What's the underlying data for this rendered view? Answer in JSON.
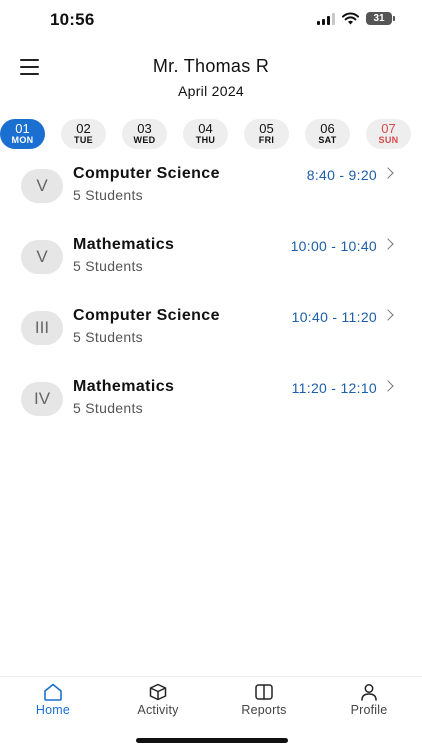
{
  "status_bar": {
    "time": "10:56",
    "battery": "31"
  },
  "header": {
    "teacher_name": "Mr. Thomas R",
    "month": "April 2024"
  },
  "days": [
    {
      "num": "01",
      "dow": "MON",
      "active": true
    },
    {
      "num": "02",
      "dow": "TUE"
    },
    {
      "num": "03",
      "dow": "WED"
    },
    {
      "num": "04",
      "dow": "THU"
    },
    {
      "num": "05",
      "dow": "FRI"
    },
    {
      "num": "06",
      "dow": "SAT"
    },
    {
      "num": "07",
      "dow": "SUN"
    }
  ],
  "classes": [
    {
      "grade": "V",
      "subject": "Computer Science",
      "students": "5 Students",
      "time": "8:40 - 9:20"
    },
    {
      "grade": "V",
      "subject": "Mathematics",
      "students": "5 Students",
      "time": "10:00 - 10:40"
    },
    {
      "grade": "III",
      "subject": "Computer Science",
      "students": "5 Students",
      "time": "10:40 - 11:20"
    },
    {
      "grade": "IV",
      "subject": "Mathematics",
      "students": "5 Students",
      "time": "11:20 - 12:10"
    }
  ],
  "tabs": [
    {
      "label": "Home",
      "icon": "home-icon"
    },
    {
      "label": "Activity",
      "icon": "cube-icon"
    },
    {
      "label": "Reports",
      "icon": "book-icon"
    },
    {
      "label": "Profile",
      "icon": "person-icon"
    }
  ],
  "colors": {
    "accent": "#1b6fd1",
    "time_text": "#1c5ea8",
    "sunday": "#d94a4a"
  }
}
